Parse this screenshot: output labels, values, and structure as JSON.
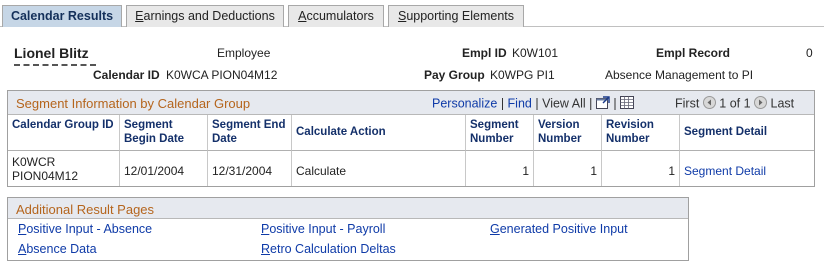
{
  "tabs": [
    {
      "label": "Calendar Results",
      "active": true
    },
    {
      "label_first": "E",
      "label_rest": "arnings and Deductions",
      "active": false
    },
    {
      "label_first": "A",
      "label_rest": "ccumulators",
      "active": false
    },
    {
      "label_first": "S",
      "label_rest": "upporting Elements",
      "active": false
    }
  ],
  "header": {
    "employee_name": "Lionel Blitz",
    "employee_label": "Employee",
    "empl_id_label": "Empl ID",
    "empl_id_value": "K0W101",
    "empl_record_label": "Empl Record",
    "empl_record_value": "0",
    "calendar_id_label": "Calendar ID",
    "calendar_id_value": "K0WCA PION04M12",
    "pay_group_label": "Pay Group",
    "pay_group_value": "K0WPG PI1",
    "pay_group_desc": "Absence Management to PI"
  },
  "segment_grid": {
    "title": "Segment Information by Calendar Group",
    "personalize": "Personalize",
    "find": "Find",
    "view_all": "View All",
    "first": "First",
    "page_info": "1 of 1",
    "last": "Last",
    "columns": {
      "calendar_group_id": "Calendar Group ID",
      "segment_begin_date": "Segment Begin Date",
      "segment_end_date": "Segment End Date",
      "calculate_action": "Calculate Action",
      "segment_number": "Segment Number",
      "version_number": "Version Number",
      "revision_number": "Revision Number",
      "segment_detail": "Segment Detail"
    },
    "row": {
      "calendar_group_id": "K0WCR PION04M12",
      "segment_begin_date": "12/01/2004",
      "segment_end_date": "12/31/2004",
      "calculate_action": "Calculate",
      "segment_number": "1",
      "version_number": "1",
      "revision_number": "1",
      "segment_detail": "Segment Detail"
    }
  },
  "additional_pages": {
    "title": "Additional Result Pages",
    "links": {
      "positive_input_absence": {
        "first": "P",
        "rest": "ositive Input - Absence"
      },
      "positive_input_payroll": {
        "first": "P",
        "rest": "ositive Input - Payroll"
      },
      "generated_positive_input": {
        "first": "G",
        "rest": "enerated Positive Input"
      },
      "absence_data": {
        "first": "A",
        "rest": "bsence Data"
      },
      "retro_calculation_deltas": {
        "first": "R",
        "rest": "etro Calculation Deltas"
      }
    }
  },
  "colors": {
    "link": "#0f3ba8",
    "section_title": "#b5651d",
    "active_tab": "#c6d6e6",
    "header_bg": "#e6e9ef"
  }
}
